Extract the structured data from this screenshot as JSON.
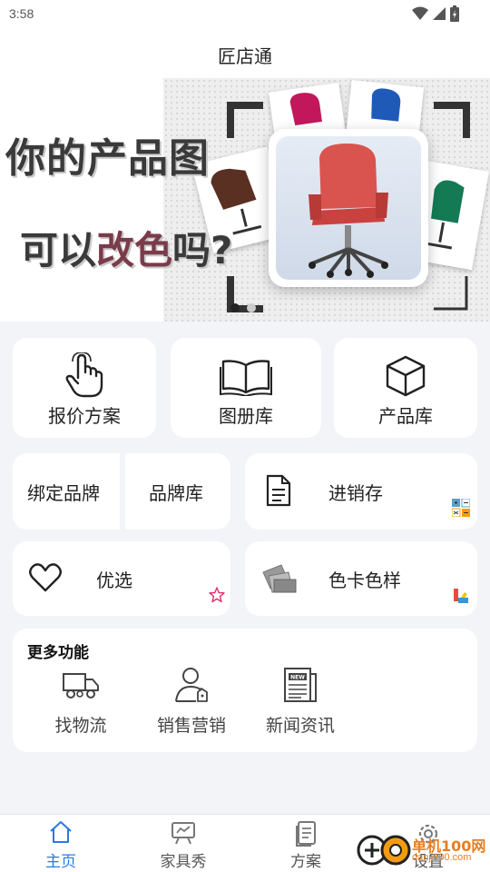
{
  "status": {
    "time": "3:58"
  },
  "app": {
    "title": "匠店通"
  },
  "banner": {
    "line1": "你的产品图",
    "line2_prefix": "可以",
    "line2_mid": "改色",
    "line2_suffix": "吗?",
    "page_count": 2,
    "active_page": 1
  },
  "tiles": [
    {
      "label": "报价方案",
      "icon": "hand-pointer-icon"
    },
    {
      "label": "图册库",
      "icon": "open-book-icon"
    },
    {
      "label": "产品库",
      "icon": "box-icon"
    }
  ],
  "row2": {
    "bind_brand": "绑定品牌",
    "brand_lib": "品牌库",
    "inventory": "进销存"
  },
  "row3": {
    "favorites": "优选",
    "color_cards": "色卡色样"
  },
  "more": {
    "title": "更多功能",
    "items": [
      {
        "label": "找物流",
        "icon": "truck-icon"
      },
      {
        "label": "销售营销",
        "icon": "salesperson-icon"
      },
      {
        "label": "新闻资讯",
        "icon": "newspaper-icon"
      }
    ]
  },
  "tabs": [
    {
      "label": "主页",
      "icon": "home-icon",
      "active": true
    },
    {
      "label": "家具秀",
      "icon": "presentation-icon",
      "active": false
    },
    {
      "label": "方案",
      "icon": "document-icon",
      "active": false
    },
    {
      "label": "设置",
      "icon": "gear-icon",
      "active": false
    }
  ],
  "watermark": {
    "brand": "单机100网",
    "url": "danji100.com"
  },
  "colors": {
    "accent": "#2b7ae0",
    "watermark": "#e67e22"
  }
}
